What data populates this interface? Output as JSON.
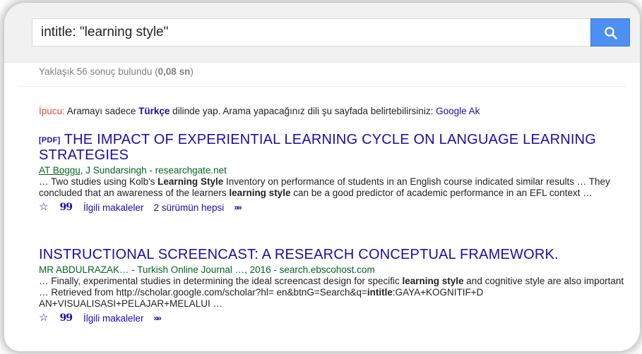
{
  "search": {
    "query": "intitle: \"learning style\"",
    "button_icon": "search-icon"
  },
  "stats": {
    "prefix": "Yaklaşık 56 sonuç bulundu (",
    "time": "0,08 sn",
    "suffix": ")"
  },
  "tip": {
    "label": "İpucu:",
    "text_before": " Aramayı sadece ",
    "language": "Türkçe",
    "text_after": " dilinde yap. Arama yapacağınız dili şu sayfada belirtebilirsiniz: ",
    "link": "Google Ak"
  },
  "results": [
    {
      "tag": "[PDF]",
      "title": "THE IMPACT OF EXPERIENTIAL LEARNING CYCLE ON LANGUAGE LEARNING STRATEGIES",
      "author_link": "AT Boggu",
      "authors_rest": ", J Sundarsingh - researchgate.net",
      "snippet_1": "… Two studies using Kolb's ",
      "snippet_b1": "Learning",
      "snippet_b2": "Style",
      "snippet_2": " Inventory on performance of students in an English course indicated similar results … They concluded that an awareness of the learners ",
      "snippet_b3": "learning style",
      "snippet_3": " can be a good predictor of academic performance in an EFL context …",
      "actions": [
        "İlgili makaleler",
        "2 sürümün hepsi"
      ]
    },
    {
      "title": "INSTRUCTIONAL SCREENCAST: A RESEARCH CONCEPTUAL FRAMEWORK.",
      "authors": "MR ABDULRAZAK… - Turkish Online Journal …, 2016 - search.ebscohost.com",
      "snippet_1": "… Finally, experimental studies in determining the ideal screencast design for specific ",
      "snippet_b1": "learning style",
      "snippet_2": " and cognitive style are also important … Retrieved from http://scholar.google.com/scholar?hl= en&btnG=Search&q=",
      "snippet_b2": "intitle",
      "snippet_3": ":GAYA+KOGNITIF+D AN+VISUALISASI+PELAJAR+MELALUI …",
      "actions": [
        "İlgili makaleler"
      ]
    }
  ],
  "icons": {
    "save": "☆",
    "cite": "99",
    "more": "»"
  }
}
